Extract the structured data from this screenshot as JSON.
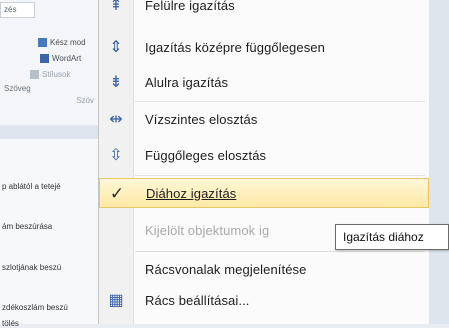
{
  "ribbon": {
    "tab_label": "zés",
    "items": [
      {
        "label": "Kész mod",
        "color": "#4a78c0"
      },
      {
        "label": "WordArt",
        "color": "#3a63a8"
      },
      {
        "label": "Stílusok",
        "color": "#7a8896"
      }
    ],
    "mini_text": "Szöveg",
    "group_label": "Szöv"
  },
  "document": {
    "rows": [
      "p ablától a tetejé",
      "ám beszúrása",
      "szlotjának beszú",
      "zdékoszlám beszú",
      "tölés"
    ]
  },
  "menu": {
    "items": [
      {
        "label": "Felülre igazítás",
        "icon": "align-top-icon",
        "glyph": "⇞",
        "state": "normal"
      },
      {
        "label": "Igazítás középre függőlegesen",
        "icon": "align-middle-icon",
        "glyph": "⇕",
        "state": "normal"
      },
      {
        "label": "Alulra igazítás",
        "icon": "align-bottom-icon",
        "glyph": "⇟",
        "state": "normal"
      },
      {
        "label": "Vízszintes elosztás",
        "icon": "distribute-horizontal-icon",
        "glyph": "⇹",
        "state": "normal"
      },
      {
        "label": "Függőleges elosztás",
        "icon": "distribute-vertical-icon",
        "glyph": "⇳",
        "state": "normal"
      },
      {
        "label": "Diához igazítás",
        "icon": "checkmark-icon",
        "glyph": "✓",
        "state": "highlighted"
      },
      {
        "label": "Kijelölt objektumok ig",
        "icon": "",
        "glyph": "",
        "state": "disabled"
      },
      {
        "label": "Rácsvonalak megjelenítése",
        "icon": "",
        "glyph": "",
        "state": "normal"
      },
      {
        "label": "Rács beállításai...",
        "icon": "grid-icon",
        "glyph": "▦",
        "state": "normal"
      }
    ]
  },
  "tooltip": {
    "text": "Igazítás diához"
  },
  "colors": {
    "accent": "#3a63a8",
    "highlight": "#ffe9a6",
    "highlight_border": "#e8c86a"
  }
}
